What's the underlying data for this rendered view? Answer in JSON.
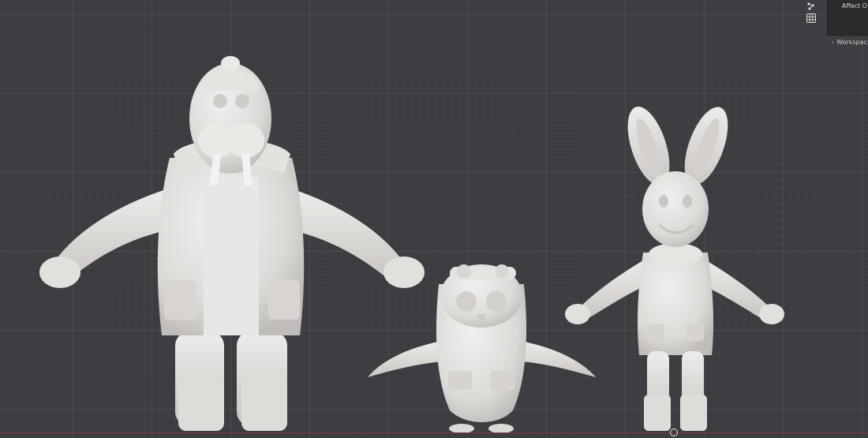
{
  "app": {
    "panel_label": "Affect O",
    "workspace_label": "Workspace"
  },
  "icons": {
    "top_tool": "scatter-icon",
    "grid_tool": "grid-icon",
    "workspace_chevron": "chevron-right-icon"
  },
  "viewport": {
    "background_color": "#3d3c41",
    "model_color": "#e8e6e4"
  },
  "workspace_chevron_glyph": "›"
}
